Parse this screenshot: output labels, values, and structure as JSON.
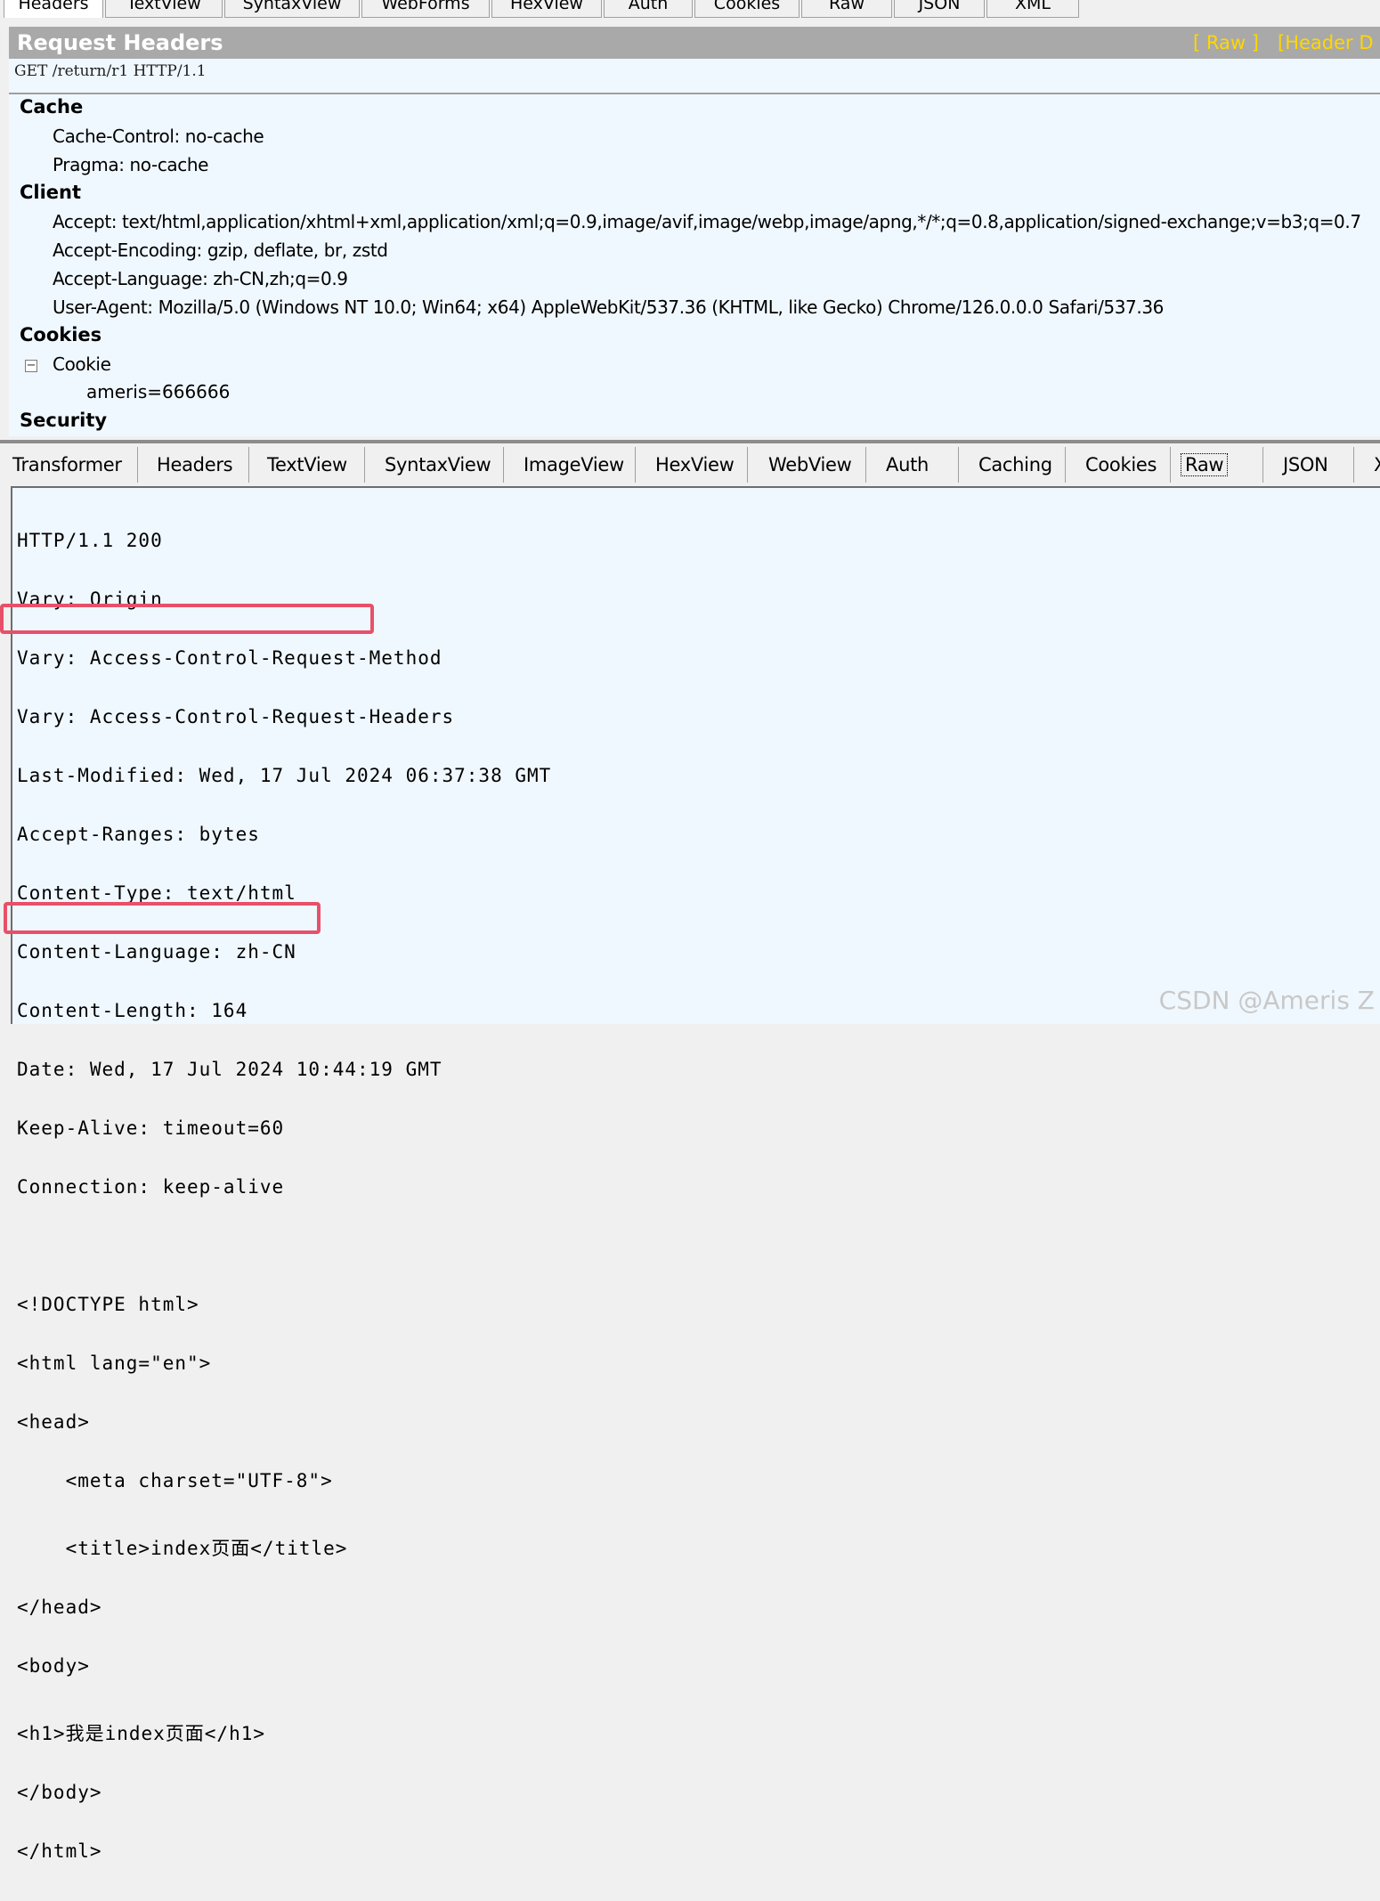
{
  "top_tabs": [
    {
      "label": "Headers",
      "active": true
    },
    {
      "label": "TextView"
    },
    {
      "label": "SyntaxView"
    },
    {
      "label": "WebForms"
    },
    {
      "label": "HexView"
    },
    {
      "label": "Auth"
    },
    {
      "label": "Cookies"
    },
    {
      "label": "Raw"
    },
    {
      "label": "JSON"
    },
    {
      "label": "XML"
    }
  ],
  "request": {
    "title": "Request Headers",
    "links": [
      "[ Raw ]",
      "[Header D"
    ],
    "request_line": "GET /return/r1 HTTP/1.1",
    "groups": [
      {
        "name": "Cache",
        "headers": [
          "Cache-Control: no-cache",
          "Pragma: no-cache"
        ]
      },
      {
        "name": "Client",
        "headers": [
          "Accept: text/html,application/xhtml+xml,application/xml;q=0.9,image/avif,image/webp,image/apng,*/*;q=0.8,application/signed-exchange;v=b3;q=0.7",
          "Accept-Encoding: gzip, deflate, br, zstd",
          "Accept-Language: zh-CN,zh;q=0.9",
          "User-Agent: Mozilla/5.0 (Windows NT 10.0; Win64; x64) AppleWebKit/537.36 (KHTML, like Gecko) Chrome/126.0.0.0 Safari/537.36"
        ]
      },
      {
        "name": "Cookies",
        "cookie_label": "Cookie",
        "cookie_value": "ameris=666666"
      },
      {
        "name": "Security"
      }
    ]
  },
  "response_tabs": [
    {
      "label": "Transformer"
    },
    {
      "label": "Headers"
    },
    {
      "label": "TextView"
    },
    {
      "label": "SyntaxView"
    },
    {
      "label": "ImageView"
    },
    {
      "label": "HexView"
    },
    {
      "label": "WebView"
    },
    {
      "label": "Auth"
    },
    {
      "label": "Caching"
    },
    {
      "label": "Cookies"
    },
    {
      "label": "Raw",
      "active": true
    },
    {
      "label": "JSON"
    },
    {
      "label": "X"
    }
  ],
  "raw_response": [
    "HTTP/1.1 200",
    "Vary: Origin",
    "Vary: Access-Control-Request-Method",
    "Vary: Access-Control-Request-Headers",
    "Last-Modified: Wed, 17 Jul 2024 06:37:38 GMT",
    "Accept-Ranges: bytes",
    "Content-Type: text/html",
    "Content-Language: zh-CN",
    "Content-Length: 164",
    "Date: Wed, 17 Jul 2024 10:44:19 GMT",
    "Keep-Alive: timeout=60",
    "Connection: keep-alive",
    "",
    "<!DOCTYPE html>",
    "<html lang=\"en\">",
    "<head>",
    "    <meta charset=\"UTF-8\">",
    "    <title>index页面</title>",
    "</head>",
    "<body>",
    "<h1>我是index页面</h1>",
    "</body>",
    "</html>"
  ],
  "watermark": "CSDN @Ameris Z",
  "colors": {
    "highlight": "#e8506a",
    "title_bar": "#a9a9a9",
    "link": "#ffd700",
    "panel_bg": "#f0f8ff"
  }
}
